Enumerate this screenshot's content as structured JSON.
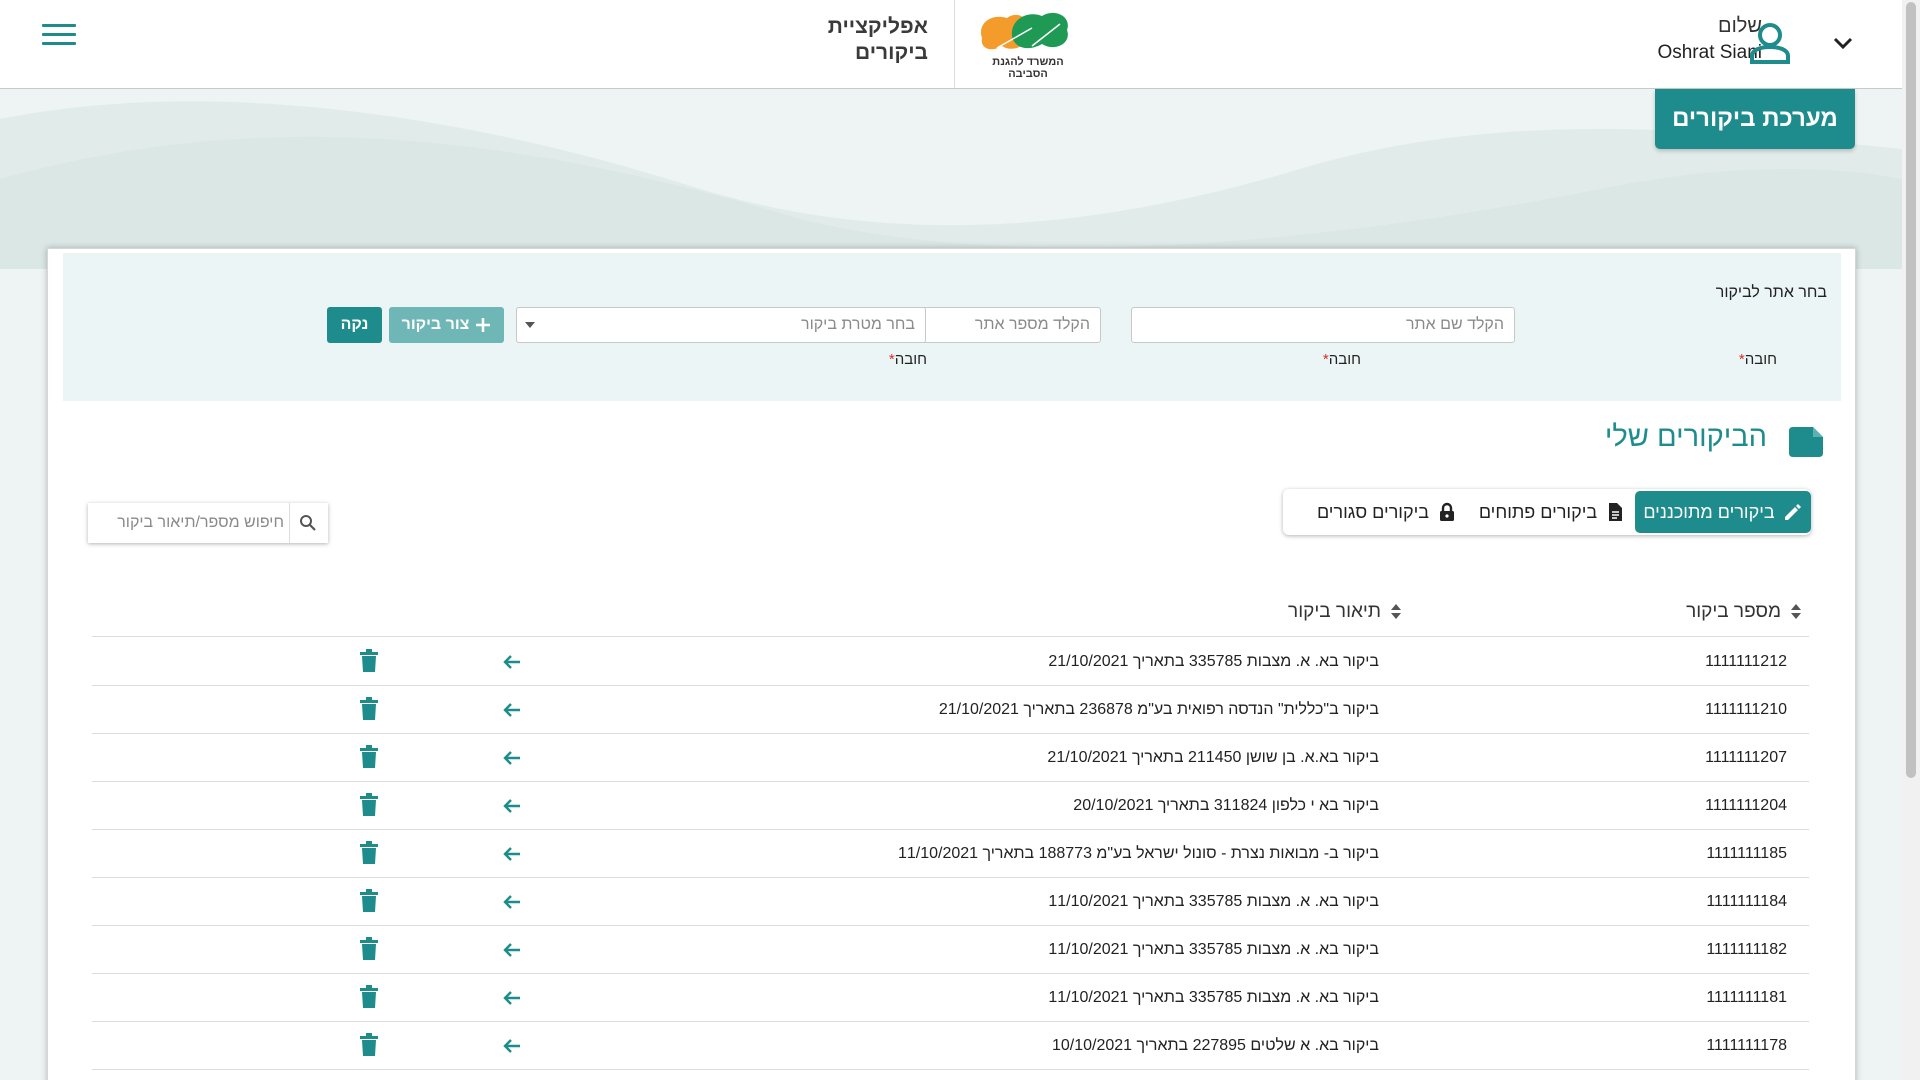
{
  "header": {
    "app_name_line1": "אפליקציית",
    "app_name_line2": "ביקורים",
    "logo_text": "המשרד להגנת הסביבה",
    "greeting": "שלום",
    "user_name": "Oshrat Siani"
  },
  "system_badge": "מערכת ביקורים",
  "filter": {
    "title": "בחר אתר לביקור",
    "site_name_placeholder": "הקלד שם אתר",
    "site_number_placeholder": "הקלד מספר אתר",
    "visit_purpose_placeholder": "בחר מטרת ביקור",
    "required_label": "חובה",
    "required_star": "*",
    "create_button": "צור ביקור",
    "clear_button": "נקה"
  },
  "section_title": "הביקורים שלי",
  "tabs": [
    {
      "label": "ביקורים מתוכננים",
      "icon": "pencil-icon",
      "active": true
    },
    {
      "label": "ביקורים פתוחים",
      "icon": "document-icon",
      "active": false
    },
    {
      "label": "ביקורים סגורים",
      "icon": "lock-icon",
      "active": false
    }
  ],
  "search": {
    "placeholder": "חיפוש מספר/תיאור ביקור"
  },
  "table": {
    "columns": [
      "מספר ביקור",
      "תיאור ביקור"
    ],
    "rows": [
      {
        "num": "1111111212",
        "desc": "ביקור בא. א. מצבות 335785 בתאריך 21/10/2021"
      },
      {
        "num": "1111111210",
        "desc": "ביקור ב\"כללית\" הנדסה רפואית בע\"מ 236878 בתאריך 21/10/2021"
      },
      {
        "num": "1111111207",
        "desc": "ביקור בא.א. בן שושן 211450 בתאריך 21/10/2021"
      },
      {
        "num": "1111111204",
        "desc": "ביקור בא י כלפון 311824 בתאריך 20/10/2021"
      },
      {
        "num": "1111111185",
        "desc": "ביקור ב- מבואות נצרת - סונול ישראל בע\"מ 188773 בתאריך 11/10/2021"
      },
      {
        "num": "1111111184",
        "desc": "ביקור בא. א. מצבות 335785 בתאריך 11/10/2021"
      },
      {
        "num": "1111111182",
        "desc": "ביקור בא. א. מצבות 335785 בתאריך 11/10/2021"
      },
      {
        "num": "1111111181",
        "desc": "ביקור בא. א. מצבות 335785 בתאריך 11/10/2021"
      },
      {
        "num": "1111111178",
        "desc": "ביקור בא. א שלטים 227895 בתאריך 10/10/2021"
      }
    ]
  },
  "colors": {
    "accent": "#1e8c8c",
    "accent_light": "#6fb7b7",
    "panel_bg": "#ebf5f5",
    "page_bg": "#eef3f3",
    "required": "#d32f2f"
  }
}
